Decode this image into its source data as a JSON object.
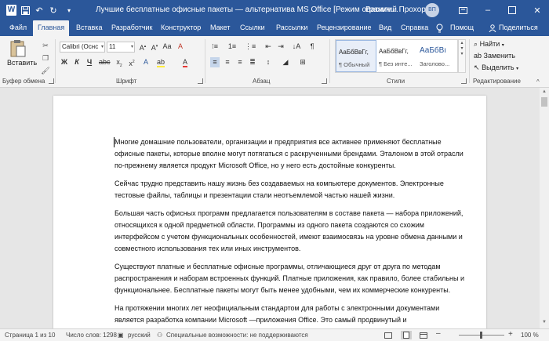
{
  "window": {
    "app_icon": "word-icon",
    "title": "Лучшие бесплатные офисные пакеты — альтернатива MS Office [Режим огранич…",
    "user": "Василий Прохоров",
    "user_initials": "ВП",
    "accent_color": "#2b579a"
  },
  "quick_access": {
    "icons": [
      "save-icon",
      "undo-icon",
      "redo-icon",
      "customize-chevron-icon"
    ]
  },
  "tabs": [
    {
      "label": "Файл",
      "active": false
    },
    {
      "label": "Главная",
      "active": true
    },
    {
      "label": "Вставка",
      "active": false
    },
    {
      "label": "Разработчик",
      "active": false
    },
    {
      "label": "Конструктор",
      "active": false
    },
    {
      "label": "Макет",
      "active": false
    },
    {
      "label": "Ссылки",
      "active": false
    },
    {
      "label": "Рассылки",
      "active": false
    },
    {
      "label": "Рецензирование",
      "active": false
    },
    {
      "label": "Вид",
      "active": false
    },
    {
      "label": "Справка",
      "active": false
    }
  ],
  "tell_me": "Помощ",
  "share": "Поделиться",
  "ribbon": {
    "clipboard": {
      "label": "Буфер обмена",
      "paste": "Вставить"
    },
    "font": {
      "label": "Шрифт",
      "family": "Calibri (Оснс",
      "size": "11",
      "bold": "Ж",
      "italic": "К",
      "underline": "Ч"
    },
    "paragraph": {
      "label": "Абзац"
    },
    "styles": {
      "label": "Стили",
      "items": [
        {
          "sample": "АаБбВвГг,",
          "name": "¶ Обычный",
          "selected": true
        },
        {
          "sample": "АаБбВвГг,",
          "name": "¶ Без инте...",
          "selected": false
        },
        {
          "sample": "АаБбВı",
          "name": "Заголово...",
          "selected": false
        }
      ]
    },
    "editing": {
      "label": "Редактирование",
      "find": "Найти",
      "replace": "Заменить",
      "select": "Выделить"
    }
  },
  "document": {
    "paragraphs": [
      "Многие домашние пользователи, организации и предприятия все активнее применяют бесплатные офисные пакеты, которые вполне могут потягаться с раскрученными брендами. Эталоном в этой отрасли по-прежнему является продукт Microsoft Office, но у него есть достойные конкуренты.",
      "Сейчас трудно представить нашу жизнь без создаваемых на компьютере документов. Электронные тестовые файлы, таблицы и презентации стали неотъемлемой частью нашей жизни.",
      "Большая часть офисных программ предлагается пользователям в составе пакета — набора приложений, относящихся к одной предметной области. Программы из одного пакета создаются со схожим интерфейсом с учетом функциональных особенностей, имеют взаимосвязь на уровне обмена данными и совместного использования тех или иных инструментов.",
      "Существуют платные и бесплатные офисные программы, отличающиеся друг от друга по методам распространения и наборам встроенных функций. Платные приложения, как правило, более стабильны и функциональнее. Бесплатные пакеты могут быть менее удобными, чем их коммерческие конкуренты.",
      "На протяжении многих лет неофициальным стандартом для работы с электронными документами является разработка компании Microsoft —приложения Office. Это самый продвинутый и"
    ]
  },
  "status": {
    "page": "Страница 1 из 10",
    "words": "Число слов: 1298",
    "language": "русский",
    "accessibility": "Специальные возможности: не поддерживаются",
    "zoom": "100 %"
  }
}
